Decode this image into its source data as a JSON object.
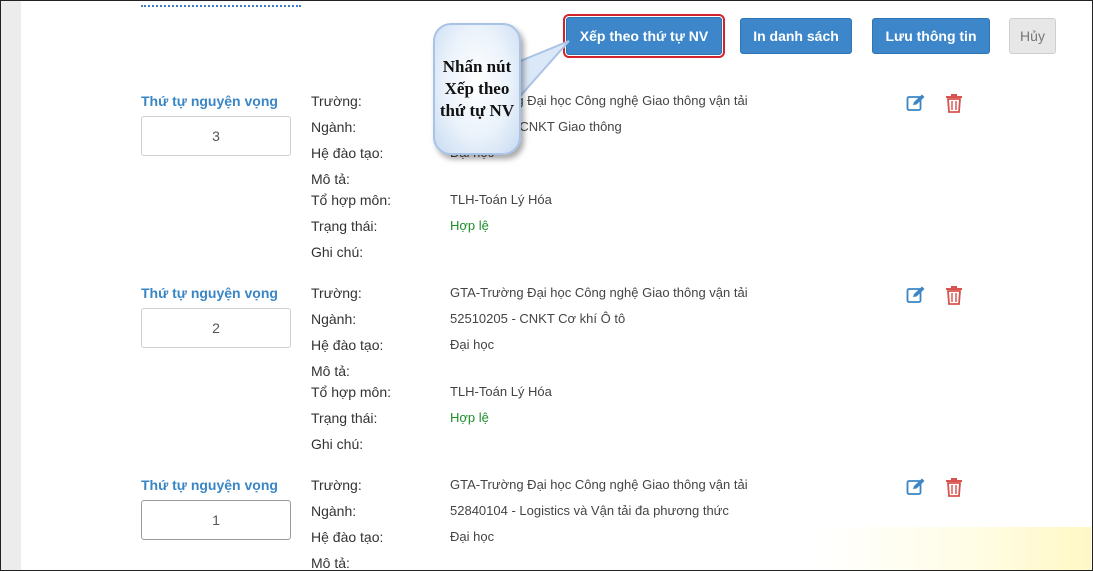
{
  "toolbar": {
    "sort_label": "Xếp theo thứ tự NV",
    "print_label": "In danh sách",
    "save_label": "Lưu thông tin",
    "cancel_label": "Hủy"
  },
  "callout": {
    "text": "Nhấn nút Xếp theo thứ tự NV"
  },
  "labels": {
    "rank": "Thứ tự nguyện vọng",
    "school": "Trường:",
    "major": "Ngành:",
    "training": "Hệ đào tạo:",
    "description": "Mô tả:",
    "subjects": "Tổ hợp môn:",
    "status": "Trạng thái:",
    "note": "Ghi chú:"
  },
  "records": [
    {
      "rank": "3",
      "school": "GTA-Trường Đại học Công nghệ Giao thông vận tải",
      "major": "52510104 - CNKT Giao thông",
      "training": "Đại học",
      "description": "",
      "subjects": "TLH-Toán Lý Hóa",
      "status": "Hợp lệ",
      "note": ""
    },
    {
      "rank": "2",
      "school": "GTA-Trường Đại học Công nghệ Giao thông vận tải",
      "major": "52510205 - CNKT Cơ khí  Ô tô",
      "training": "Đại học",
      "description": "",
      "subjects": "TLH-Toán Lý Hóa",
      "status": "Hợp lệ",
      "note": ""
    },
    {
      "rank": "1",
      "school": "GTA-Trường Đại học Công nghệ Giao thông vận tải",
      "major": "52840104 - Logistics và Vận tải đa phương thức",
      "training": "Đại học",
      "description": ""
    }
  ],
  "icons": {
    "edit": "edit-icon",
    "delete": "trash-icon"
  },
  "colors": {
    "primary": "#3c86c9",
    "highlight": "#d3232a",
    "label_blue": "#3a86c5",
    "valid_green": "#1d8f2a",
    "delete_red": "#d9534f"
  }
}
